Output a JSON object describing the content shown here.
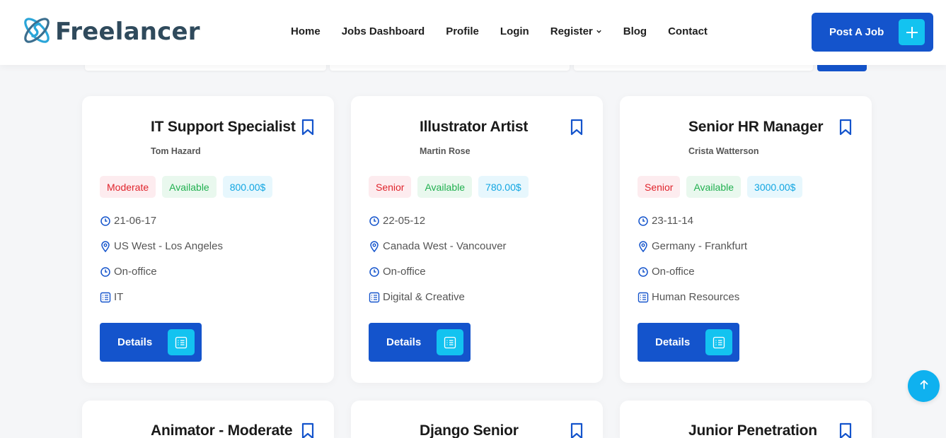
{
  "brand": {
    "name": "Freelancer"
  },
  "nav": {
    "items": [
      {
        "label": "Home"
      },
      {
        "label": "Jobs Dashboard"
      },
      {
        "label": "Profile"
      },
      {
        "label": "Login"
      },
      {
        "label": "Register"
      },
      {
        "label": "Blog"
      },
      {
        "label": "Contact"
      }
    ]
  },
  "header": {
    "post_job_label": "Post A Job"
  },
  "colors": {
    "primary": "#1454cc",
    "accent": "#13c3f0",
    "level": "#e0242c",
    "available": "#21b050",
    "price": "#12a6e2"
  },
  "jobs": [
    {
      "title": "IT Support Specialist",
      "author": "Tom Hazard",
      "level": "Moderate",
      "status": "Available",
      "price": "800.00$",
      "date": "21-06-17",
      "location": "US West - Los Angeles",
      "work_type": "On-office",
      "category": "IT",
      "details_label": "Details"
    },
    {
      "title": "Illustrator Artist",
      "author": "Martin Rose",
      "level": "Senior",
      "status": "Available",
      "price": "780.00$",
      "date": "22-05-12",
      "location": "Canada West - Vancouver",
      "work_type": "On-office",
      "category": "Digital & Creative",
      "details_label": "Details"
    },
    {
      "title": "Senior HR Manager",
      "author": "Crista Watterson",
      "level": "Senior",
      "status": "Available",
      "price": "3000.00$",
      "date": "23-11-14",
      "location": "Germany - Frankfurt",
      "work_type": "On-office",
      "category": "Human Resources",
      "details_label": "Details"
    },
    {
      "title": "Animator - Moderate"
    },
    {
      "title": "Django Senior"
    },
    {
      "title": "Junior Penetration"
    }
  ]
}
